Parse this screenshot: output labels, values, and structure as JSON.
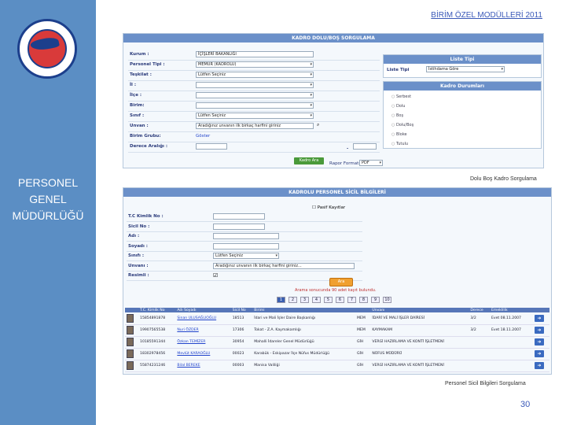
{
  "header": {
    "title": "BİRİM ÖZEL MODÜLLERİ 2011"
  },
  "sidebar": {
    "org_lines": [
      "PERSONEL",
      "GENEL",
      "MÜDÜRLÜĞÜ"
    ]
  },
  "colors": {
    "sidebar": "#5b8ec4",
    "panel_header": "#6b90c9",
    "accent_blue": "#3a59b8"
  },
  "top_panel": {
    "header": "KADRO DOLU/BOŞ SORGULAMA",
    "fields": [
      {
        "label": "Kurum :",
        "value": "İÇİŞLERİ BAKANLIĞI"
      },
      {
        "label": "Personel Tipi :",
        "value": "MEMUR (KADROLU)"
      },
      {
        "label": "Teşkilat :",
        "value": "Lütfen Seçiniz"
      },
      {
        "label": "İl :",
        "value": ""
      },
      {
        "label": "İlçe :",
        "value": ""
      },
      {
        "label": "Birim:",
        "value": ""
      },
      {
        "label": "Sınıf :",
        "value": "Lütfen Seçiniz"
      },
      {
        "label": "Unvan :",
        "value": "Aradığınız unvanın ilk birkaç harfini giriniz"
      },
      {
        "label": "Birim Grubu:",
        "value": "Göster"
      },
      {
        "label": "Derece Aralığı :",
        "value": ""
      }
    ],
    "degree_sep": "-",
    "liste_tipi": {
      "header": "Liste Tipi",
      "label": "Liste Tipi",
      "value": "İstihdama Göre"
    },
    "kadro_durumu": {
      "header": "Kadro Durumları",
      "options": [
        "Serbest",
        "Dolu",
        "Boş",
        "Dolu/Boş",
        "Bloke",
        "Tutulu"
      ]
    },
    "search_button": "Kadro Ara",
    "report_label": "Rapor Formatı :",
    "report_value": "PDF"
  },
  "caption_top": "Dolu Boş Kadro Sorgulama",
  "bottom_panel": {
    "header": "KADROLU PERSONEL SİCİL BİLGİLERİ",
    "checkbox_label": "Pasif Kayıtlar",
    "fields": [
      {
        "label": "T.C Kimlik No :",
        "value": ""
      },
      {
        "label": "Sicil No :",
        "value": ""
      },
      {
        "label": "Adı :",
        "value": ""
      },
      {
        "label": "Soyadı :",
        "value": ""
      },
      {
        "label": "Sınıfı :",
        "value": "Lütfen Seçiniz"
      },
      {
        "label": "Unvanı :",
        "value": "Aradığınız unvanın ilk birkaç harfini giriniz..."
      },
      {
        "label": "Resimli :",
        "value": ""
      }
    ],
    "search_button": "Ara",
    "result_info": "Arama sonucunda 90 adet kayıt bulundu.",
    "pages": [
      "1",
      "2",
      "3",
      "4",
      "5",
      "6",
      "7",
      "8",
      "9",
      "10"
    ],
    "columns": [
      "T.C. Kimlik No",
      "Adı Soyadı",
      "Sicil No",
      "Birimi",
      "",
      "Unvanı",
      "Derece",
      "Emeklilik"
    ],
    "rows": [
      {
        "tc": "15854891878",
        "name": "Sinan ULUSAĞLIOĞLU",
        "sicil": "18513",
        "birim": "İdari ve Mali İşler Daire Başkanlığı",
        "tip": "MEM",
        "unvan": "İDARİ VE MALİ İŞLER DAİRESİ",
        "derece": "3/2",
        "emek": "Evet 08.11.2007"
      },
      {
        "tc": "19907565538",
        "name": "Nuri ÖZDER",
        "sicil": "17306",
        "birim": "Tokat - Z.A. Kaymakamlığı",
        "tip": "MEM",
        "unvan": "KAYMAKAM",
        "derece": "3/2",
        "emek": "Evet 18.11.2007"
      },
      {
        "tc": "10185591344",
        "name": "Özkan TEMİZER",
        "sicil": "30954",
        "birim": "Mahalli İdareler Genel Müdürlüğü",
        "tip": "GİH",
        "unvan": "VERGİ HAZIRLAMA VE KONTİ İŞLETMENİ",
        "derece": "",
        "emek": ""
      },
      {
        "tc": "18302978456",
        "name": "Mevlüt KARAOĞLU",
        "sicil": "00023",
        "birim": "Karabük - Eskipazar İlçe Nüfus Müdürlüğü",
        "tip": "GİH",
        "unvan": "NÜFUS MÜDÜRÜ",
        "derece": "",
        "emek": ""
      },
      {
        "tc": "55874231246",
        "name": "Bilal BEREKE",
        "sicil": "00003",
        "birim": "Manisa Valiliği",
        "tip": "GİH",
        "unvan": "VERGİ HAZIRLAMA VE KONTİ İŞLETMENİ",
        "derece": "",
        "emek": ""
      }
    ]
  },
  "caption_bottom": "Personel Sicil Bilgileri Sorgulama",
  "page_number": "30"
}
